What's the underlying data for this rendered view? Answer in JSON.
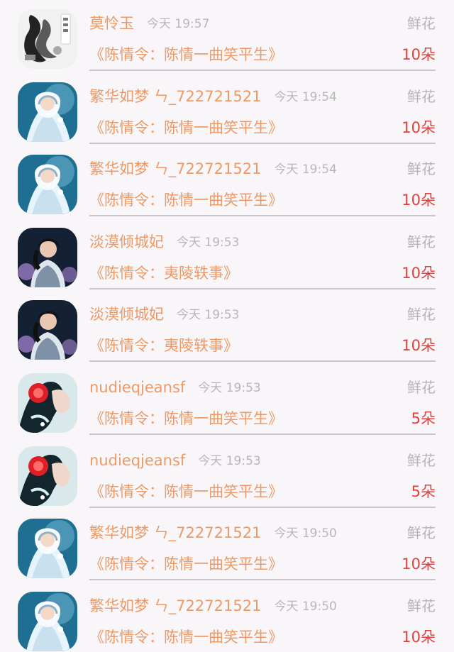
{
  "gifts": [
    {
      "avatar": "book-cover-avatar",
      "name": "莫怜玉",
      "time": "今天 19:57",
      "gift": "鲜花",
      "book": "《陈情令：陈情一曲笑平生》",
      "qty": "10朵"
    },
    {
      "avatar": "white-fairy-avatar",
      "name": "繁华如梦 ㄣ_722721521",
      "time": "今天 19:54",
      "gift": "鲜花",
      "book": "《陈情令：陈情一曲笑平生》",
      "qty": "10朵"
    },
    {
      "avatar": "white-fairy-avatar",
      "name": "繁华如梦 ㄣ_722721521",
      "time": "今天 19:54",
      "gift": "鲜花",
      "book": "《陈情令：陈情一曲笑平生》",
      "qty": "10朵"
    },
    {
      "avatar": "dark-robed-man-avatar",
      "name": "淡漠倾城妃",
      "time": "今天 19:53",
      "gift": "鲜花",
      "book": "《陈情令：夷陵轶事》",
      "qty": "10朵"
    },
    {
      "avatar": "dark-robed-man-avatar",
      "name": "淡漠倾城妃",
      "time": "今天 19:53",
      "gift": "鲜花",
      "book": "《陈情令：夷陵轶事》",
      "qty": "10朵"
    },
    {
      "avatar": "red-flower-woman-avatar",
      "name": "nudieqjeansf",
      "time": "今天 19:53",
      "gift": "鲜花",
      "book": "《陈情令：陈情一曲笑平生》",
      "qty": "5朵"
    },
    {
      "avatar": "red-flower-woman-avatar",
      "name": "nudieqjeansf",
      "time": "今天 19:53",
      "gift": "鲜花",
      "book": "《陈情令：陈情一曲笑平生》",
      "qty": "5朵"
    },
    {
      "avatar": "white-fairy-avatar",
      "name": "繁华如梦 ㄣ_722721521",
      "time": "今天 19:50",
      "gift": "鲜花",
      "book": "《陈情令：陈情一曲笑平生》",
      "qty": "10朵"
    },
    {
      "avatar": "white-fairy-avatar",
      "name": "繁华如梦 ㄣ_722721521",
      "time": "今天 19:50",
      "gift": "鲜花",
      "book": "《陈情令：陈情一曲笑平生》",
      "qty": "10朵"
    }
  ],
  "colors": {
    "background": "#f8f6f8",
    "name_text": "#ec9a68",
    "book_text": "#ec9a68",
    "quantity_text": "#e2403c",
    "secondary_text": "#b9b6b9",
    "divider": "#c9c6c9"
  }
}
